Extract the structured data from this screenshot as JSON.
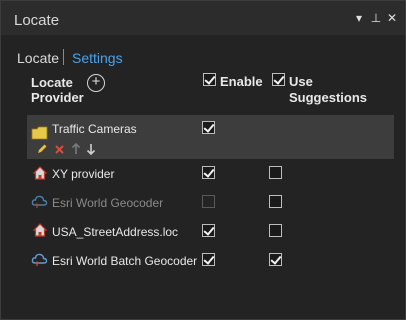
{
  "window": {
    "title": "Locate",
    "controls": {
      "dropdown": "▾",
      "pin": "⊥",
      "close": "✕"
    }
  },
  "tabs": {
    "locate": "Locate",
    "settings": "Settings",
    "active": "Settings"
  },
  "headers": {
    "locate_provider_1": "Locate",
    "locate_provider_2": "Provider",
    "enable": "Enable",
    "use_suggestions_1": "Use",
    "use_suggestions_2": "Suggestions"
  },
  "providers": [
    {
      "name": "Traffic Cameras",
      "icon": "folder-layer-icon",
      "enabled": true,
      "suggestions": null,
      "selected": true
    },
    {
      "name": "XY provider",
      "icon": "house-locator-icon",
      "enabled": true,
      "suggestions": false,
      "selected": false
    },
    {
      "name": "Esri World Geocoder",
      "icon": "cloud-locator-icon",
      "enabled": false,
      "suggestions": false,
      "selected": false,
      "dimmed": true
    },
    {
      "name": "USA_StreetAddress.loc",
      "icon": "house-locator-icon",
      "enabled": true,
      "suggestions": false,
      "selected": false
    },
    {
      "name": "Esri World Batch Geocoder",
      "icon": "cloud-locator-icon",
      "enabled": true,
      "suggestions": true,
      "selected": false
    }
  ],
  "row_actions": [
    "edit-icon",
    "remove-icon",
    "move-up-icon",
    "move-down-icon"
  ],
  "colors": {
    "accent": "#4aa3f0",
    "selected_row": "#3d3d3d",
    "remove": "#e04a3a",
    "edit": "#e8c040",
    "folder": "#e8c84a"
  }
}
